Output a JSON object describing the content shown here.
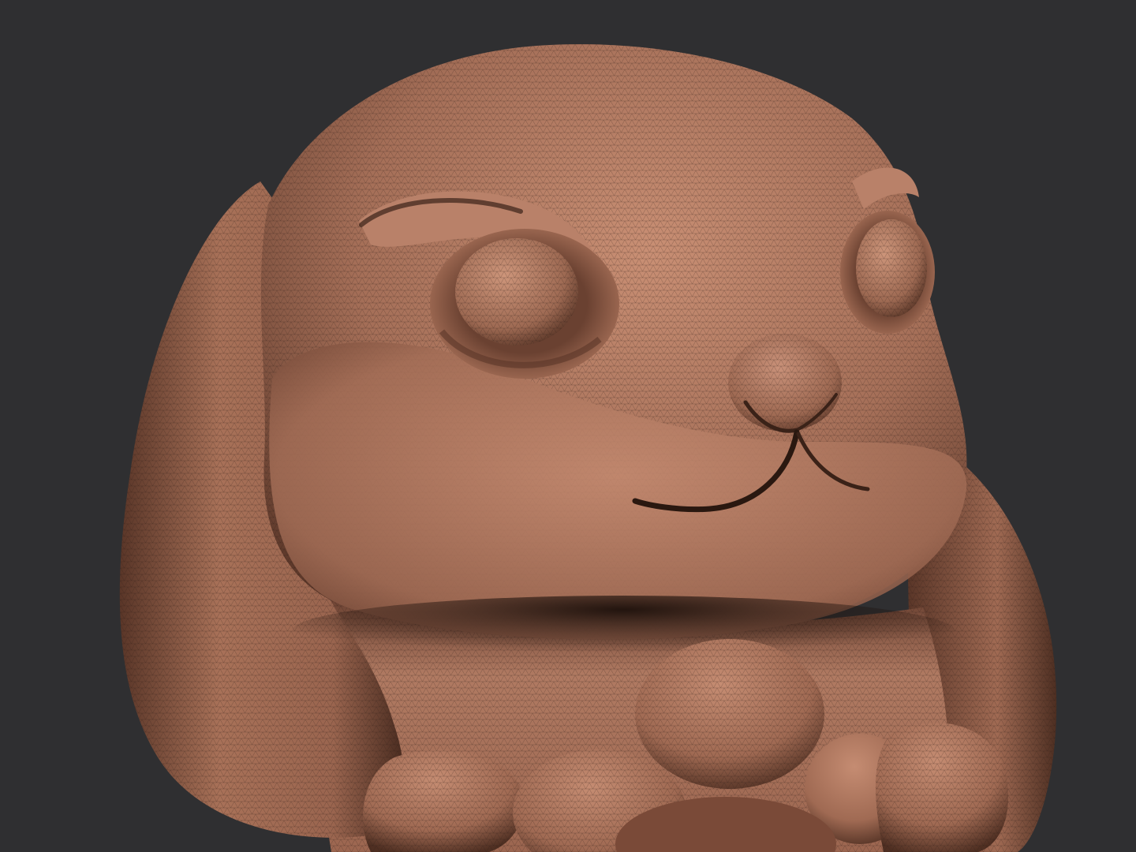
{
  "viewport": {
    "background_color": "#2f2f31",
    "model": {
      "subject": "bunny-sculpt",
      "material_color": "#b07a62",
      "shadow_color": "#3a2218",
      "highlight_color": "#d6a088",
      "wireframe_color": "#2a1a14"
    }
  }
}
